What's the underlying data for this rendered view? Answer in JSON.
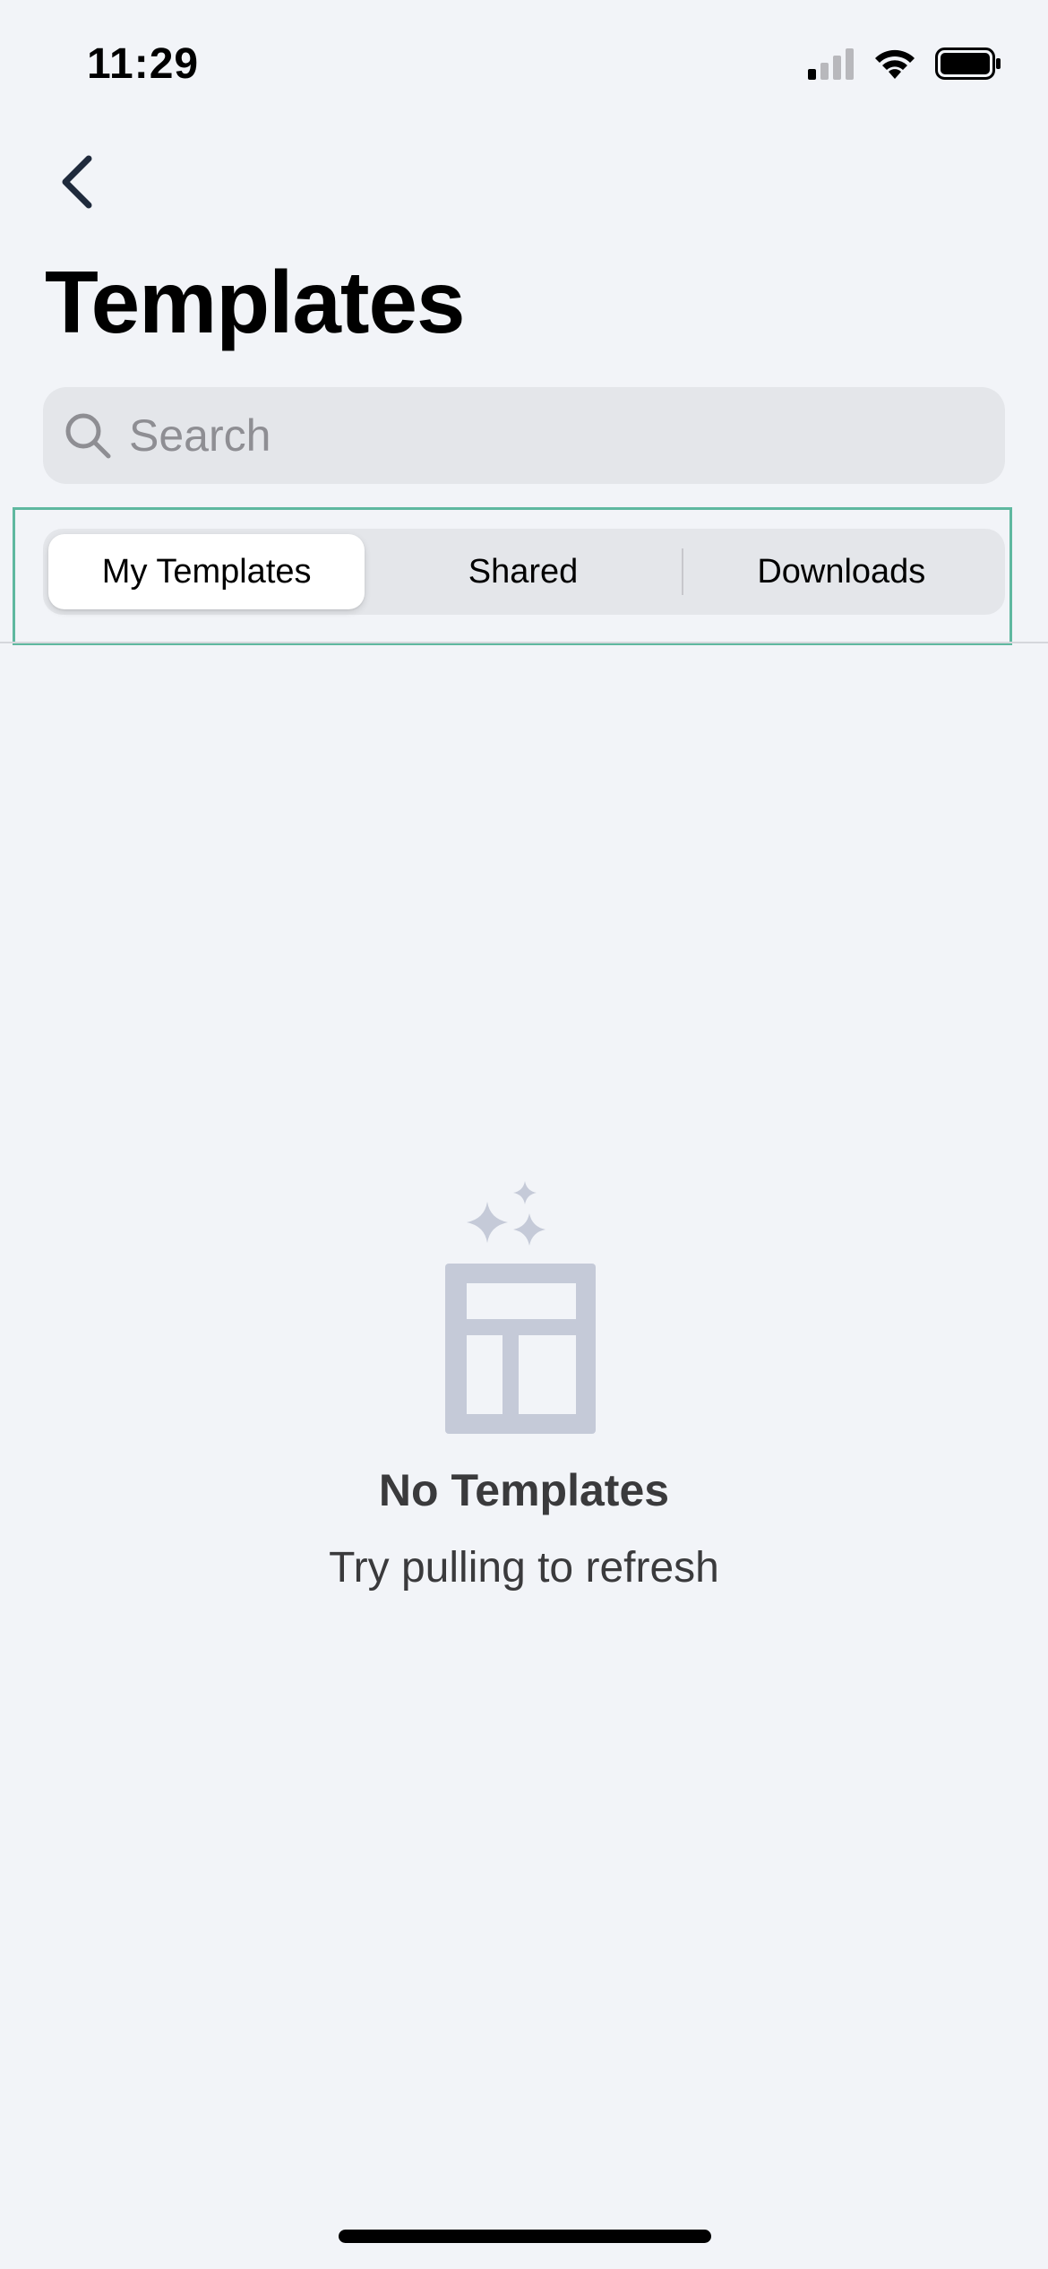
{
  "status_bar": {
    "time": "11:29",
    "icons": [
      "cellular-signal-icon",
      "wifi-icon",
      "battery-icon"
    ]
  },
  "navigation": {
    "back_icon": "chevron-left-icon"
  },
  "header": {
    "title": "Templates"
  },
  "search": {
    "placeholder": "Search",
    "value": "",
    "icon": "search-icon"
  },
  "segments": {
    "items": [
      {
        "label": "My Templates",
        "selected": true
      },
      {
        "label": "Shared",
        "selected": false
      },
      {
        "label": "Downloads",
        "selected": false
      }
    ]
  },
  "empty_state": {
    "icon": "template-sparkle-icon",
    "title": "No Templates",
    "subtitle": "Try pulling to refresh"
  },
  "colors": {
    "background": "#f2f4f8",
    "search_bg": "#e4e6ea",
    "highlight_border": "#5fb8a0",
    "empty_icon": "#c5cad8",
    "back_chevron": "#1f2a3c"
  }
}
